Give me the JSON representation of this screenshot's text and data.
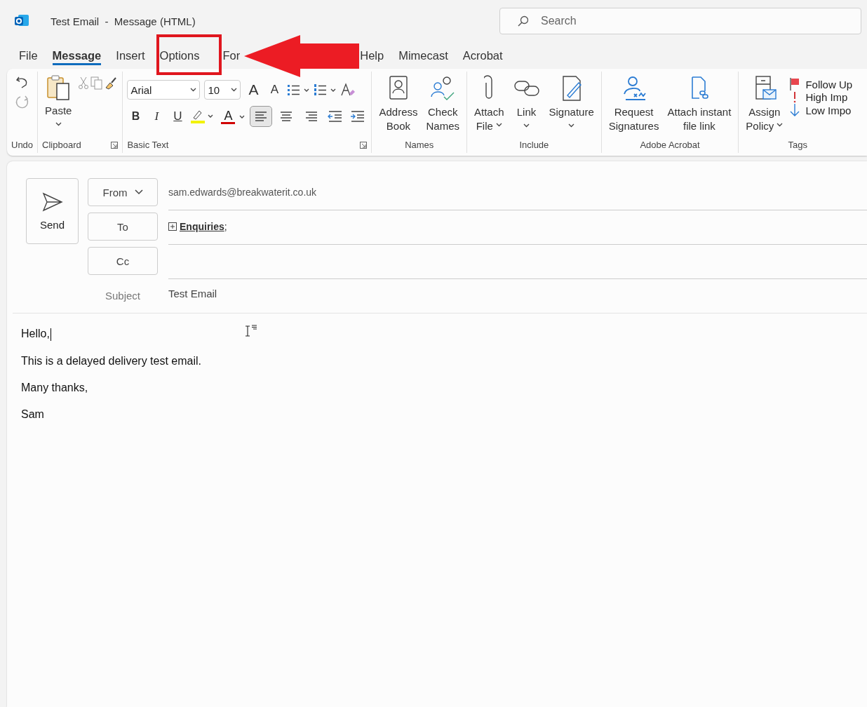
{
  "window": {
    "title": "Test Email  -  Message (HTML)"
  },
  "search": {
    "placeholder": "Search"
  },
  "tabs": [
    {
      "label": "File",
      "selected": false
    },
    {
      "label": "Message",
      "selected": true
    },
    {
      "label": "Insert",
      "selected": false
    },
    {
      "label": "Options",
      "selected": false
    },
    {
      "label": "For",
      "selected": false
    },
    {
      "label": "Help",
      "selected": false
    },
    {
      "label": "Mimecast",
      "selected": false
    },
    {
      "label": "Acrobat",
      "selected": false
    }
  ],
  "ribbon": {
    "undo": {
      "label": "Undo"
    },
    "clipboard": {
      "label": "Clipboard",
      "paste": "Paste"
    },
    "basic_text": {
      "label": "Basic Text",
      "font": "Arial",
      "size": "10",
      "grow": "A",
      "shrink": "A",
      "bold": "B",
      "italic": "I",
      "underline": "U",
      "font_color": "A",
      "alignments": [
        {
          "selected": true
        },
        {
          "selected": false
        },
        {
          "selected": false
        }
      ]
    },
    "groups": [
      {
        "label": "Names",
        "buttons": [
          {
            "lines": [
              "Address",
              "Book"
            ],
            "dropdown": false
          },
          {
            "lines": [
              "Check",
              "Names"
            ],
            "dropdown": false
          }
        ]
      },
      {
        "label": "Include",
        "buttons": [
          {
            "lines": [
              "Attach",
              "File"
            ],
            "dropdown": true
          },
          {
            "lines": [
              "Link"
            ],
            "dropdown": true
          },
          {
            "lines": [
              "Signature"
            ],
            "dropdown": true
          }
        ]
      },
      {
        "label": "Adobe Acrobat",
        "buttons": [
          {
            "lines": [
              "Request",
              "Signatures"
            ],
            "dropdown": false
          },
          {
            "lines": [
              "Attach instant",
              "file link"
            ],
            "dropdown": false
          }
        ]
      },
      {
        "label": "Tags",
        "buttons": [
          {
            "lines": [
              "Assign",
              "Policy"
            ],
            "dropdown": true
          }
        ],
        "items": [
          "Follow Up",
          "High Imp",
          "Low Impo"
        ]
      }
    ]
  },
  "compose": {
    "send": "Send",
    "from_label": "From",
    "from_value": "sam.edwards@breakwaterit.co.uk",
    "to_label": "To",
    "to_value": "**Enquiries**;",
    "cc_label": "Cc",
    "subject_label": "Subject",
    "subject_value": "Test Email"
  },
  "body": [
    "Hello,",
    "This is a delayed delivery test email.",
    "Many thanks,",
    "Sam"
  ]
}
